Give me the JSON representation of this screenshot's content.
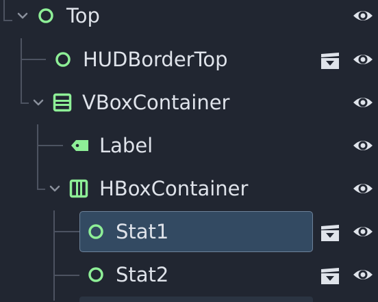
{
  "panel": "scene-tree",
  "nodes": [
    {
      "label": "Top",
      "icon": "control-node-icon",
      "expanded": true,
      "visibility": "visible",
      "has_scene_instance": false,
      "selected": false
    },
    {
      "label": "HUDBorderTop",
      "icon": "control-node-icon",
      "expanded": null,
      "visibility": "visible",
      "has_scene_instance": true,
      "selected": false
    },
    {
      "label": "VBoxContainer",
      "icon": "vbox-container-icon",
      "expanded": true,
      "visibility": "visible",
      "has_scene_instance": false,
      "selected": false
    },
    {
      "label": "Label",
      "icon": "label-node-icon",
      "expanded": null,
      "visibility": "visible",
      "has_scene_instance": false,
      "selected": false
    },
    {
      "label": "HBoxContainer",
      "icon": "hbox-container-icon",
      "expanded": true,
      "visibility": "visible",
      "has_scene_instance": false,
      "selected": false
    },
    {
      "label": "Stat1",
      "icon": "control-node-icon",
      "expanded": null,
      "visibility": "visible",
      "has_scene_instance": true,
      "selected": true
    },
    {
      "label": "Stat2",
      "icon": "control-node-icon",
      "expanded": null,
      "visibility": "visible",
      "has_scene_instance": true,
      "selected": false
    }
  ],
  "colors": {
    "background": "#212631",
    "node_icon": "#8eef97",
    "text": "#dfe3ea",
    "selection_fill": "#334a62",
    "selection_border": "#6d829a",
    "guide_line": "#4d5361",
    "icon_light": "#dfe3ea"
  }
}
